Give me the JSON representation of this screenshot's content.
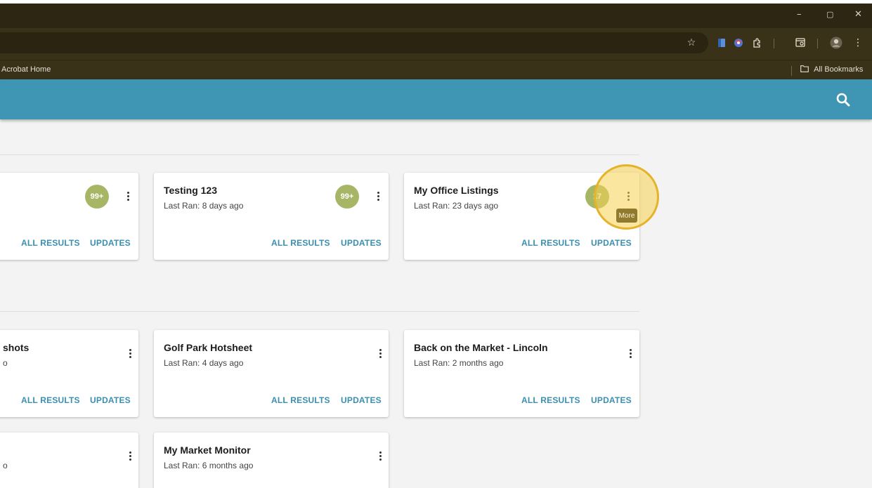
{
  "browser": {
    "window_controls": {
      "minimize": "–",
      "restore": "▢",
      "close": "✕"
    },
    "toolbar_icons": [
      "star-icon",
      "extension-blue-icon",
      "extension-color-icon",
      "puzzle-icon",
      "tab-search-icon",
      "profile-avatar-icon",
      "menu-kebab-icon"
    ],
    "bookmarks": {
      "left_item": "Acrobat Home",
      "all_bookmarks": "All Bookmarks"
    }
  },
  "appbar": {
    "color": "#3f95b4",
    "search_icon": "search-icon"
  },
  "cards": [
    {
      "title": "",
      "sub": "",
      "badge": "99+",
      "all_results": "ALL RESULTS",
      "updates": "UPDATES"
    },
    {
      "title": "Testing 123",
      "sub": "Last Ran: 8 days ago",
      "badge": "99+",
      "all_results": "ALL RESULTS",
      "updates": "UPDATES"
    },
    {
      "title": "My Office Listings",
      "sub": "Last Ran: 23 days ago",
      "badge": "17",
      "all_results": "ALL RESULTS",
      "updates": "UPDATES"
    },
    {
      "title": "shots",
      "sub": "o",
      "all_results": "ALL RESULTS",
      "updates": "UPDATES"
    },
    {
      "title": "Golf Park Hotsheet",
      "sub": "Last Ran: 4 days ago",
      "all_results": "ALL RESULTS",
      "updates": "UPDATES"
    },
    {
      "title": "Back on the Market - Lincoln",
      "sub": "Last Ran: 2 months ago",
      "all_results": "ALL RESULTS",
      "updates": "UPDATES"
    },
    {
      "title": "",
      "sub": "o"
    },
    {
      "title": "My Market Monitor",
      "sub": "Last Ran: 6 months ago"
    }
  ],
  "tooltip": {
    "text": "More"
  },
  "colors": {
    "badge": "#a6b665",
    "link": "#3a8fb0",
    "highlight": "#e5b32a"
  }
}
